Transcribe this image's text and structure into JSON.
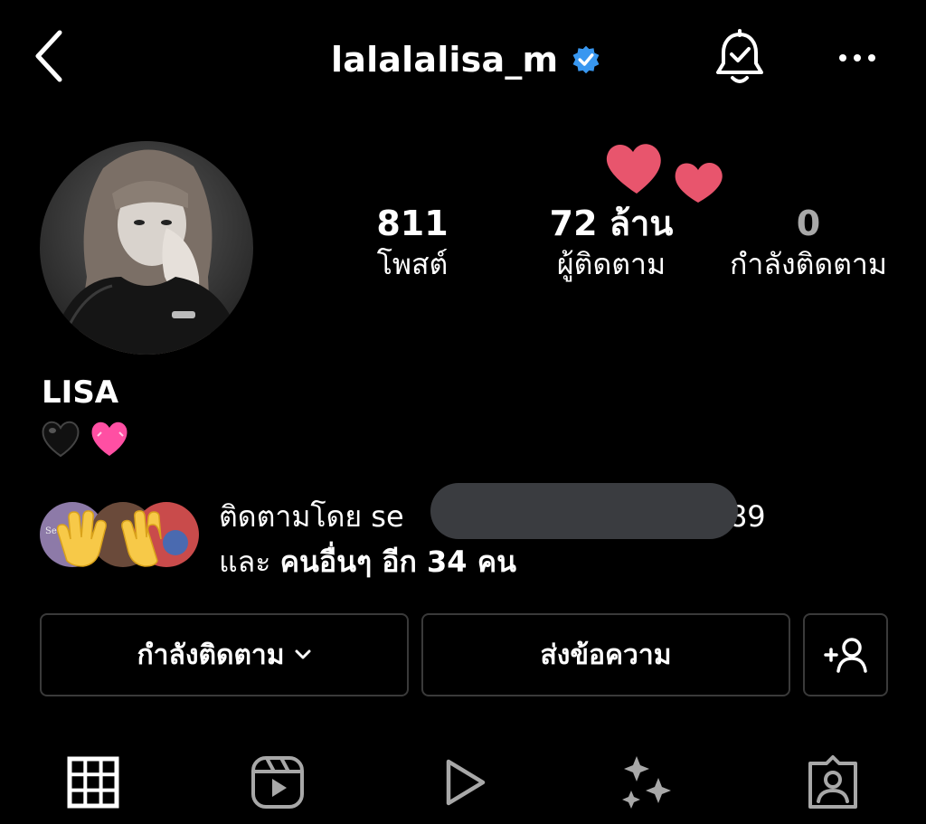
{
  "header": {
    "username": "lalalalisa_m",
    "verified": true,
    "back_icon": "chevron-left-icon",
    "bell_icon": "notification-bell-check-icon",
    "more_icon": "more-horizontal-icon"
  },
  "stats": {
    "posts": {
      "value": "811",
      "label": "โพสต์"
    },
    "followers": {
      "value": "72 ล้าน",
      "label": "ผู้ติดตาม"
    },
    "following": {
      "value": "0",
      "label": "กำลังติดตาม"
    }
  },
  "bio": {
    "display_name": "LISA",
    "emoji": [
      "🖤",
      "💗"
    ]
  },
  "followed_by": {
    "line1_prefix": "ติดตามโดย ",
    "line1_user_start": "se",
    "line1_user_end": "k8589",
    "line2_and": "และ ",
    "line2_rest": "คนอื่นๆ อีก 34 คน"
  },
  "buttons": {
    "following_label": "กำลังติดตาม",
    "message_label": "ส่งข้อความ",
    "suggest_icon": "add-person-icon"
  },
  "tabs": [
    {
      "name": "grid",
      "icon": "grid-icon",
      "active": true
    },
    {
      "name": "reels",
      "icon": "reels-icon",
      "active": false
    },
    {
      "name": "videos",
      "icon": "play-icon",
      "active": false
    },
    {
      "name": "effects",
      "icon": "sparkles-icon",
      "active": false
    },
    {
      "name": "tagged",
      "icon": "tagged-person-icon",
      "active": false
    }
  ],
  "colors": {
    "background": "#000000",
    "text": "#ffffff",
    "muted": "#a8a8a8",
    "verified_blue": "#3897f0",
    "border": "#3a3a3a",
    "heart_pink": "#e8556d"
  }
}
